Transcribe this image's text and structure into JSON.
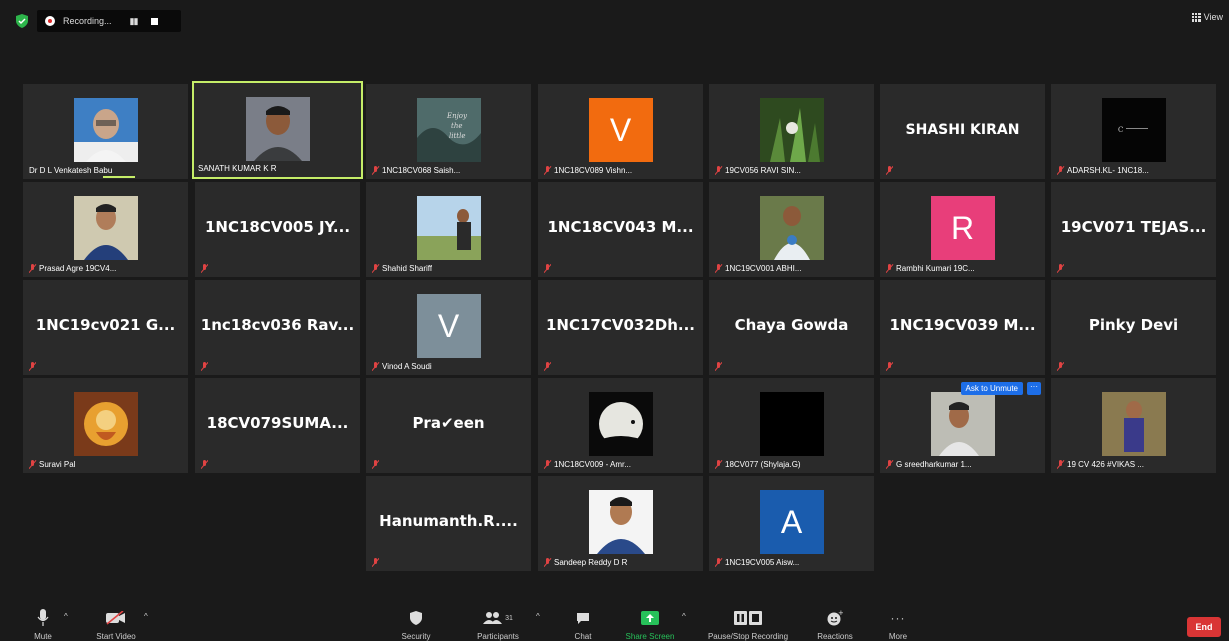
{
  "topbar": {
    "recording_label": "Recording...",
    "view_label": "View"
  },
  "tiles": [
    {
      "name": "Dr D L Venkatesh Babu"
    },
    {
      "name": "SANATH KUMAR K R"
    },
    {
      "name": "1NC18CV068 Saish..."
    },
    {
      "name": "1NC18CV089 Vishn...",
      "letter": "V"
    },
    {
      "name": "19CV056 RAVI SIN..."
    },
    {
      "big": "SHASHI KIRAN"
    },
    {
      "name": "ADARSH.KL- 1NC18..."
    },
    {
      "name": "Prasad Agre 19CV4..."
    },
    {
      "big": "1NC18CV005 JY..."
    },
    {
      "name": "Shahid Shariff"
    },
    {
      "big": "1NC18CV043 M..."
    },
    {
      "name": "1NC19CV001 ABHI..."
    },
    {
      "name": "Rambhi Kumari 19C...",
      "letter": "R"
    },
    {
      "big": "19CV071 TEJAS..."
    },
    {
      "big": "1NC19cv021 G..."
    },
    {
      "big": "1nc18cv036 Rav..."
    },
    {
      "name": "Vinod A Soudi",
      "letter": "V"
    },
    {
      "big": "1NC17CV032Dh..."
    },
    {
      "big": "Chaya Gowda"
    },
    {
      "big": "1NC19CV039 M..."
    },
    {
      "big": "Pinky Devi"
    },
    {
      "name": "Suravi Pal"
    },
    {
      "big": "18CV079SUMA..."
    },
    {
      "big": "Pra✔een"
    },
    {
      "name": "1NC18CV009 - Amr..."
    },
    {
      "name": "18CV077 (Shylaja.G)"
    },
    {
      "name": "G sreedharkumar 1...",
      "ask": "Ask to Unmute",
      "more": "···"
    },
    {
      "name": "19 CV 426 #VIKAS ..."
    },
    {
      "big": "Hanumanth.R...."
    },
    {
      "name": "Sandeep Reddy D R"
    },
    {
      "name": "1NC19CV005 Aisw...",
      "letter": "A"
    }
  ],
  "toolbar": {
    "mute": "Mute",
    "start_video": "Start Video",
    "security": "Security",
    "participants": "Participants",
    "participants_count": "31",
    "chat": "Chat",
    "share_screen": "Share Screen",
    "pause_stop": "Pause/Stop Recording",
    "reactions": "Reactions",
    "more": "More",
    "end": "End"
  },
  "colors": {
    "background": "#1a1a1a",
    "tile": "#2a2a2a",
    "active_speaker": "#c5ed68",
    "end_button": "#d93535",
    "muted_icon": "#e04343",
    "share_green": "#27c15a",
    "ask_unmute": "#1d6ee8"
  }
}
